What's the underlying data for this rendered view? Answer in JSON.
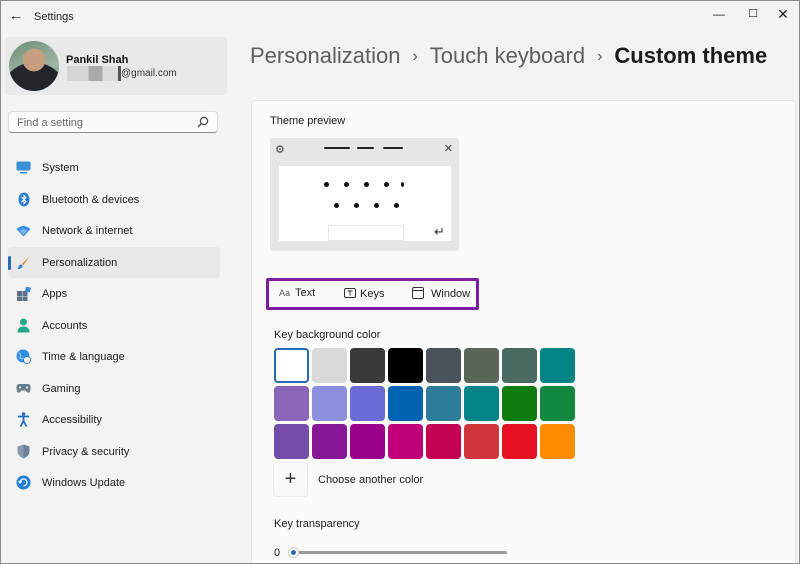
{
  "window": {
    "title": "Settings",
    "back_icon": "←",
    "minimize_icon": "—",
    "maximize_icon": "☐",
    "close_icon": "✕"
  },
  "profile": {
    "name": "Pankil Shah",
    "email_suffix": "@gmail.com"
  },
  "search": {
    "placeholder": "Find a setting"
  },
  "sidebar": {
    "items": [
      {
        "label": "System",
        "icon": "monitor-icon"
      },
      {
        "label": "Bluetooth & devices",
        "icon": "bluetooth-icon"
      },
      {
        "label": "Network & internet",
        "icon": "wifi-icon"
      },
      {
        "label": "Personalization",
        "icon": "brush-icon",
        "active": true
      },
      {
        "label": "Apps",
        "icon": "apps-icon"
      },
      {
        "label": "Accounts",
        "icon": "person-icon"
      },
      {
        "label": "Time & language",
        "icon": "globe-clock-icon"
      },
      {
        "label": "Gaming",
        "icon": "gamepad-icon"
      },
      {
        "label": "Accessibility",
        "icon": "accessibility-icon"
      },
      {
        "label": "Privacy & security",
        "icon": "shield-icon"
      },
      {
        "label": "Windows Update",
        "icon": "update-icon"
      }
    ]
  },
  "breadcrumb": {
    "items": [
      "Personalization",
      "Touch keyboard",
      "Custom theme"
    ],
    "separator": "›"
  },
  "main": {
    "theme_preview_label": "Theme preview",
    "tabs": [
      {
        "label": "Text",
        "icon": "text-aa-icon"
      },
      {
        "label": "Keys",
        "icon": "keys-icon"
      },
      {
        "label": "Window",
        "icon": "window-icon"
      }
    ],
    "key_bg_label": "Key background color",
    "swatch_colors": [
      "#ffffff",
      "#d9d9d9",
      "#3a3a3a",
      "#000000",
      "#4a535c",
      "#5b6659",
      "#4a6b62",
      "#008486",
      "#8a65b8",
      "#8c8fdb",
      "#6b6bd5",
      "#0063b1",
      "#2d7d9a",
      "#038387",
      "#107c10",
      "#10893e",
      "#744da9",
      "#881798",
      "#9a0089",
      "#bf0077",
      "#c30052",
      "#d13438",
      "#e81123",
      "#ff8c00"
    ],
    "selected_swatch": 0,
    "choose_color_label": "Choose another color",
    "key_transparency_label": "Key transparency",
    "transparency_value": "0"
  },
  "colors": {
    "accent": "#2b6cb0",
    "highlight_box": "#7b1fa2"
  }
}
